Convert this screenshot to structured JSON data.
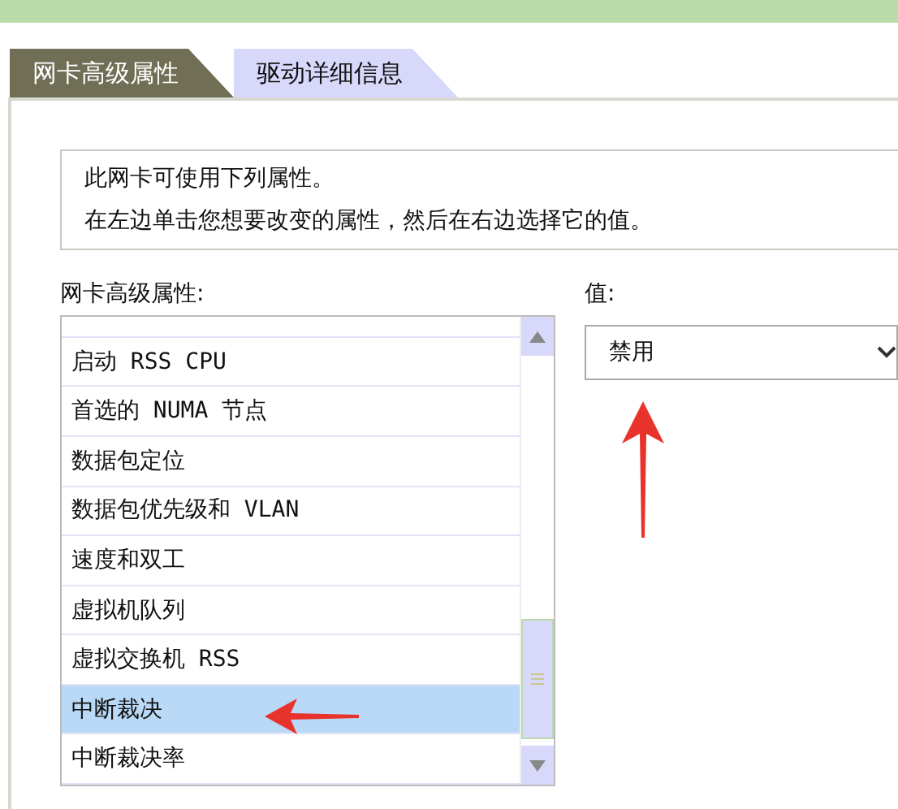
{
  "tabs": [
    {
      "label": "网卡高级属性",
      "selected": true
    },
    {
      "label": "驱动详细信息",
      "selected": false
    }
  ],
  "description": [
    "此网卡可使用下列属性。",
    "在左边单击您想要改变的属性，然后在右边选择它的值。"
  ],
  "property_list": {
    "label": "网卡高级属性:",
    "items": [
      {
        "label": "启动 RSS CPU",
        "selected": false
      },
      {
        "label": "首选的 NUMA 节点",
        "selected": false
      },
      {
        "label": "数据包定位",
        "selected": false
      },
      {
        "label": "数据包优先级和 VLAN",
        "selected": false
      },
      {
        "label": "速度和双工",
        "selected": false
      },
      {
        "label": "虚拟机队列",
        "selected": false
      },
      {
        "label": "虚拟交换机 RSS",
        "selected": false
      },
      {
        "label": "中断裁决",
        "selected": true
      },
      {
        "label": "中断裁决率",
        "selected": false
      }
    ]
  },
  "value": {
    "label": "值:",
    "selected_value": "禁用"
  }
}
